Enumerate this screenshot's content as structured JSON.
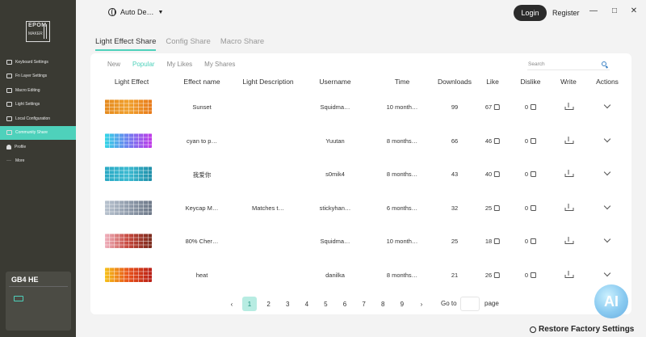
{
  "app": {
    "logo_line1": "EPOM",
    "logo_line2": "MAKER"
  },
  "sidebar": {
    "items": [
      {
        "label": "Keyboard Settings",
        "icon": "keyboard-icon"
      },
      {
        "label": "Fn Layer Settings",
        "icon": "layer-icon"
      },
      {
        "label": "Macro Editing",
        "icon": "macro-icon"
      },
      {
        "label": "Light Settings",
        "icon": "light-icon"
      },
      {
        "label": "Local Configuration",
        "icon": "config-icon"
      },
      {
        "label": "Community Share",
        "icon": "community-icon",
        "active": true
      },
      {
        "label": "Profile",
        "icon": "person-icon"
      },
      {
        "label": "More",
        "icon": "more-icon"
      }
    ],
    "device_name": "GB4 HE"
  },
  "topbar": {
    "language": "Auto De…",
    "login": "Login",
    "register": "Register",
    "minimize": "—",
    "maximize": "□",
    "close": "✕"
  },
  "tabs": [
    "Light Effect Share",
    "Config Share",
    "Macro Share"
  ],
  "filters": [
    "New",
    "Popular",
    "My Likes",
    "My Shares"
  ],
  "search": {
    "placeholder": "Search"
  },
  "columns": [
    "Light Effect",
    "Effect name",
    "Light Description",
    "Username",
    "Time",
    "Downloads",
    "Like",
    "Dislike",
    "Write",
    "Actions"
  ],
  "rows": [
    {
      "name": "Sunset",
      "desc": "",
      "user": "Squidma…",
      "time": "10 month…",
      "downloads": "99",
      "likes": "67",
      "dislikes": "0",
      "colors": [
        "#e58a1f",
        "#f0a02c",
        "#e87a1a"
      ]
    },
    {
      "name": "cyan to p…",
      "desc": "",
      "user": "Yuutan",
      "time": "8 months…",
      "downloads": "66",
      "likes": "46",
      "dislikes": "0",
      "colors": [
        "#33d6e6",
        "#6f7df0",
        "#c13ae8"
      ]
    },
    {
      "name": "我爱你",
      "desc": "",
      "user": "s0mik4",
      "time": "8 months…",
      "downloads": "43",
      "likes": "40",
      "dislikes": "0",
      "colors": [
        "#2aa9c4",
        "#3bbad1",
        "#1f8ea8"
      ]
    },
    {
      "name": "Keycap M…",
      "desc": "Matches t…",
      "user": "stickyhan…",
      "time": "6 months…",
      "downloads": "32",
      "likes": "25",
      "dislikes": "0",
      "colors": [
        "#b9c3cf",
        "#8f9bab",
        "#6d7888"
      ]
    },
    {
      "name": "80% Cher…",
      "desc": "",
      "user": "Squidma…",
      "time": "10 month…",
      "downloads": "25",
      "likes": "18",
      "dislikes": "0",
      "colors": [
        "#f0b2bf",
        "#c6453a",
        "#7a2a1c"
      ]
    },
    {
      "name": "heat",
      "desc": "",
      "user": "danilka",
      "time": "8 months…",
      "downloads": "21",
      "likes": "26",
      "dislikes": "0",
      "colors": [
        "#f6c21a",
        "#e8521b",
        "#b81f18"
      ]
    }
  ],
  "pagination": {
    "prev": "‹",
    "pages": [
      "1",
      "2",
      "3",
      "4",
      "5",
      "6",
      "7",
      "8",
      "9"
    ],
    "current": "1",
    "next": "›",
    "goto_label": "Go to",
    "page_label": "page"
  },
  "footer": {
    "restore": "Restore Factory Settings"
  },
  "watermark": "AI",
  "accent": "#4ed1bb"
}
